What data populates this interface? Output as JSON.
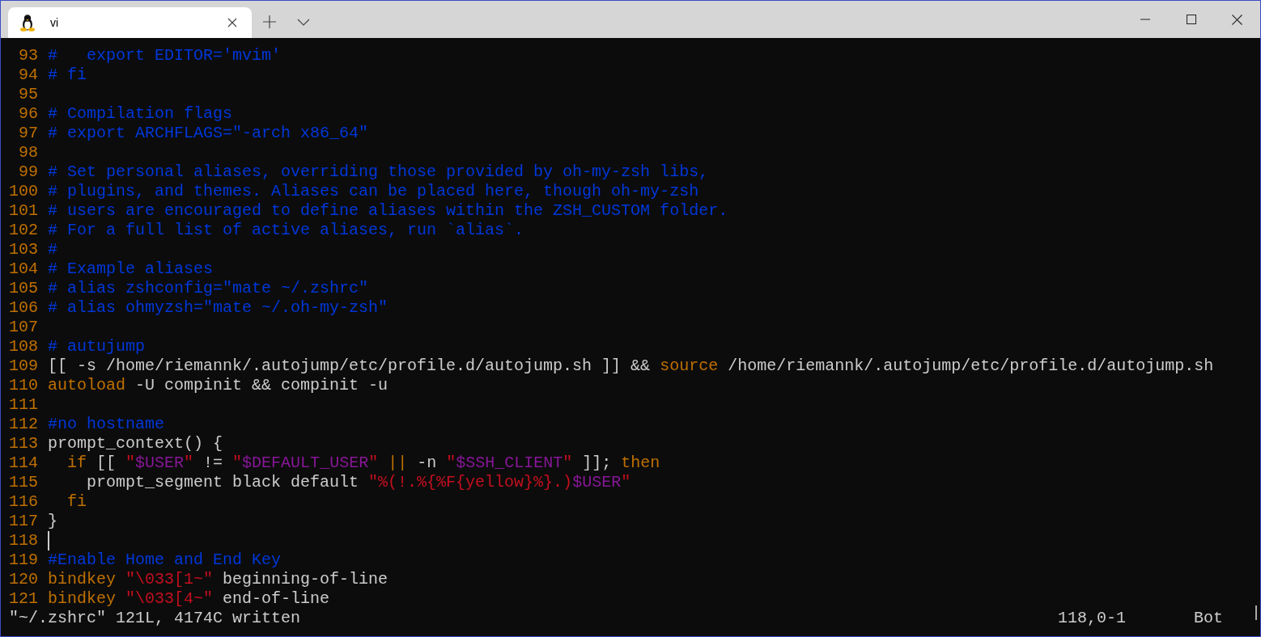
{
  "tab": {
    "title": "vi",
    "selected": true
  },
  "lines": [
    {
      "number": "93",
      "cursor": false,
      "segments": [
        {
          "kind": "comment",
          "text": "#   export EDITOR='mvim'"
        }
      ]
    },
    {
      "number": "94",
      "cursor": false,
      "segments": [
        {
          "kind": "comment",
          "text": "# fi"
        }
      ]
    },
    {
      "number": "95",
      "cursor": false
    },
    {
      "number": "96",
      "cursor": false,
      "segments": [
        {
          "kind": "comment",
          "text": "# Compilation flags"
        }
      ]
    },
    {
      "number": "97",
      "cursor": false,
      "segments": [
        {
          "kind": "comment",
          "text": "# export ARCHFLAGS=\"-arch x86_64\""
        }
      ]
    },
    {
      "number": "98",
      "cursor": false
    },
    {
      "number": "99",
      "cursor": false,
      "segments": [
        {
          "kind": "comment",
          "text": "# Set personal aliases, overriding those provided by oh-my-zsh libs,"
        }
      ]
    },
    {
      "number": "100",
      "cursor": false,
      "segments": [
        {
          "kind": "comment",
          "text": "# plugins, and themes. Aliases can be placed here, though oh-my-zsh"
        }
      ]
    },
    {
      "number": "101",
      "cursor": false,
      "segments": [
        {
          "kind": "comment",
          "text": "# users are encouraged to define aliases within the ZSH_CUSTOM folder."
        }
      ]
    },
    {
      "number": "102",
      "cursor": false,
      "segments": [
        {
          "kind": "comment",
          "text": "# For a full list of active aliases, run `alias`."
        }
      ]
    },
    {
      "number": "103",
      "cursor": false,
      "segments": [
        {
          "kind": "comment",
          "text": "#"
        }
      ]
    },
    {
      "number": "104",
      "cursor": false,
      "segments": [
        {
          "kind": "comment",
          "text": "# Example aliases"
        }
      ]
    },
    {
      "number": "105",
      "cursor": false,
      "segments": [
        {
          "kind": "comment",
          "text": "# alias zshconfig=\"mate ~/.zshrc\""
        }
      ]
    },
    {
      "number": "106",
      "cursor": false,
      "segments": [
        {
          "kind": "comment",
          "text": "# alias ohmyzsh=\"mate ~/.oh-my-zsh\""
        }
      ]
    },
    {
      "number": "107",
      "cursor": false
    },
    {
      "number": "108",
      "cursor": false,
      "segments": [
        {
          "kind": "comment",
          "text": "# autujump"
        }
      ]
    },
    {
      "number": "109",
      "cursor": false,
      "segments": [
        {
          "kind": "plain",
          "text": "[[ -s /home/riemannk/.autojump/etc/profile.d/autojump.sh ]] && "
        },
        {
          "kind": "keyword",
          "text": "source"
        },
        {
          "kind": "plain",
          "text": " /home/riemannk/.autojump/etc/profile.d/autojump.sh"
        }
      ]
    },
    {
      "number": "110",
      "cursor": false,
      "segments": [
        {
          "kind": "keyword",
          "text": "autoload"
        },
        {
          "kind": "plain",
          "text": " -U compinit && compinit -u"
        }
      ]
    },
    {
      "number": "111",
      "cursor": false
    },
    {
      "number": "112",
      "cursor": false,
      "segments": [
        {
          "kind": "comment",
          "text": "#no hostname"
        }
      ]
    },
    {
      "number": "113",
      "cursor": false,
      "segments": [
        {
          "kind": "plain",
          "text": "prompt_context() {"
        }
      ]
    },
    {
      "number": "114",
      "cursor": false,
      "segments": [
        {
          "kind": "keyword",
          "text": "  if"
        },
        {
          "kind": "plain",
          "text": " [[ "
        },
        {
          "kind": "string",
          "text": "\""
        },
        {
          "kind": "variable",
          "text": "$USER"
        },
        {
          "kind": "string",
          "text": "\""
        },
        {
          "kind": "plain",
          "text": " != "
        },
        {
          "kind": "string",
          "text": "\""
        },
        {
          "kind": "variable",
          "text": "$DEFAULT_USER"
        },
        {
          "kind": "string",
          "text": "\""
        },
        {
          "kind": "keyword",
          "text": " ||"
        },
        {
          "kind": "plain",
          "text": " -n "
        },
        {
          "kind": "string",
          "text": "\""
        },
        {
          "kind": "variable",
          "text": "$SSH_CLIENT"
        },
        {
          "kind": "string",
          "text": "\""
        },
        {
          "kind": "plain",
          "text": " ]]; "
        },
        {
          "kind": "keyword",
          "text": "then"
        }
      ]
    },
    {
      "number": "115",
      "cursor": false,
      "segments": [
        {
          "kind": "plain",
          "text": "    prompt_segment black default "
        },
        {
          "kind": "string",
          "text": "\"%(!.%{%F{yellow}%}.)"
        },
        {
          "kind": "variable",
          "text": "$USER"
        },
        {
          "kind": "string",
          "text": "\""
        }
      ]
    },
    {
      "number": "116",
      "cursor": false,
      "segments": [
        {
          "kind": "keyword",
          "text": "  fi"
        }
      ]
    },
    {
      "number": "117",
      "cursor": false,
      "segments": [
        {
          "kind": "plain",
          "text": "}"
        }
      ]
    },
    {
      "number": "118",
      "cursor": true
    },
    {
      "number": "119",
      "cursor": false,
      "segments": [
        {
          "kind": "comment",
          "text": "#Enable Home and End Key"
        }
      ]
    },
    {
      "number": "120",
      "cursor": false,
      "segments": [
        {
          "kind": "keyword",
          "text": "bindkey"
        },
        {
          "kind": "string",
          "text": " \"\\033[1~\""
        },
        {
          "kind": "plain",
          "text": " beginning-of-line"
        }
      ]
    },
    {
      "number": "121",
      "cursor": false,
      "segments": [
        {
          "kind": "keyword",
          "text": "bindkey"
        },
        {
          "kind": "string",
          "text": " \"\\033[4~\""
        },
        {
          "kind": "plain",
          "text": " end-of-line"
        }
      ]
    }
  ],
  "status_bar": {
    "message": "\"~/.zshrc\" 121L, 4174C written",
    "position": "118,0-1",
    "scroll": "Bot"
  }
}
